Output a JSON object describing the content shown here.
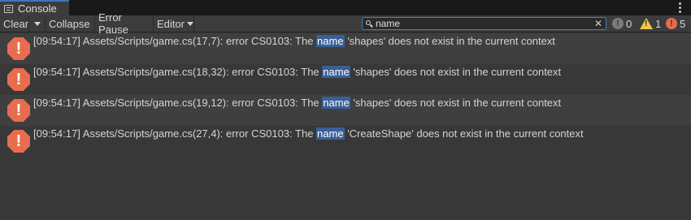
{
  "tab": {
    "title": "Console",
    "icon": "console-icon",
    "menu_icon": "kebab-menu-icon"
  },
  "toolbar": {
    "clear_label": "Clear",
    "collapse_label": "Collapse",
    "error_pause_label": "Error Pause",
    "editor_label": "Editor",
    "search": {
      "value": "name",
      "placeholder": ""
    },
    "counts": {
      "info": "0",
      "warnings": "1",
      "errors": "5"
    }
  },
  "colors": {
    "accent": "#3e7fd0",
    "error": "#e86d4e",
    "warning": "#f0c64a",
    "highlight": "#3a5f96"
  },
  "entries": [
    {
      "before": "[09:54:17] Assets/Scripts/game.cs(17,7): error CS0103: The ",
      "match": "name",
      "after": " 'shapes' does not exist in the current context"
    },
    {
      "before": "[09:54:17] Assets/Scripts/game.cs(18,32): error CS0103: The ",
      "match": "name",
      "after": " 'shapes' does not exist in the current context"
    },
    {
      "before": "[09:54:17] Assets/Scripts/game.cs(19,12): error CS0103: The ",
      "match": "name",
      "after": " 'shapes' does not exist in the current context"
    },
    {
      "before": "[09:54:17] Assets/Scripts/game.cs(27,4): error CS0103: The ",
      "match": "name",
      "after": " 'CreateShape' does not exist in the current context"
    }
  ]
}
